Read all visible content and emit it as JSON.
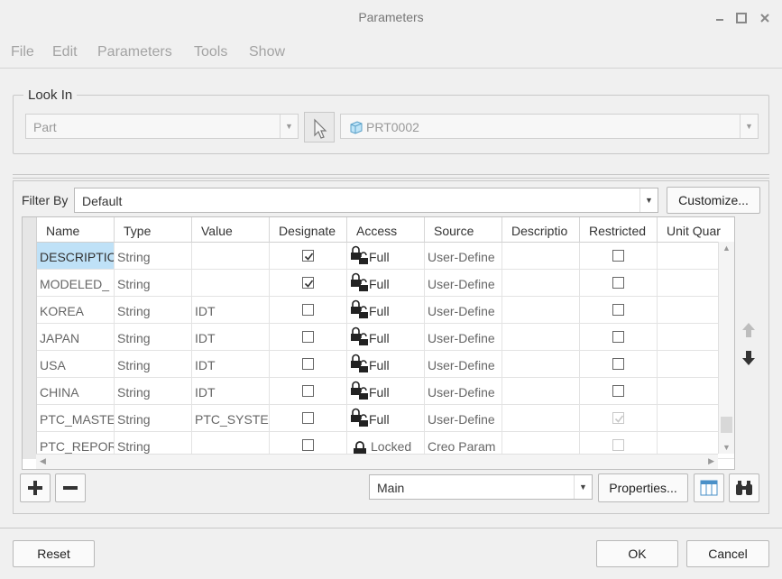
{
  "window": {
    "title": "Parameters"
  },
  "menu": [
    "File",
    "Edit",
    "Parameters",
    "Tools",
    "Show"
  ],
  "look_in": {
    "legend": "Look In",
    "type_value": "Part",
    "model_value": "PRT0002"
  },
  "filter": {
    "label": "Filter By",
    "value": "Default",
    "customize_label": "Customize..."
  },
  "table": {
    "columns": [
      "Name",
      "Type",
      "Value",
      "Designate",
      "Access",
      "Source",
      "Descriptio",
      "Restricted",
      "Unit Quar"
    ],
    "rows": [
      {
        "name": "DESCRIPTIC",
        "type": "String",
        "value": "",
        "designate": true,
        "access": "Full",
        "source": "User-Define",
        "description": "",
        "restricted": false,
        "restricted_disabled": false,
        "selected": true
      },
      {
        "name": "MODELED_",
        "type": "String",
        "value": "",
        "designate": true,
        "access": "Full",
        "source": "User-Define",
        "description": "",
        "restricted": false,
        "restricted_disabled": false,
        "selected": false
      },
      {
        "name": "KOREA",
        "type": "String",
        "value": "IDT",
        "designate": false,
        "access": "Full",
        "source": "User-Define",
        "description": "",
        "restricted": false,
        "restricted_disabled": false,
        "selected": false
      },
      {
        "name": "JAPAN",
        "type": "String",
        "value": "IDT",
        "designate": false,
        "access": "Full",
        "source": "User-Define",
        "description": "",
        "restricted": false,
        "restricted_disabled": false,
        "selected": false
      },
      {
        "name": "USA",
        "type": "String",
        "value": "IDT",
        "designate": false,
        "access": "Full",
        "source": "User-Define",
        "description": "",
        "restricted": false,
        "restricted_disabled": false,
        "selected": false
      },
      {
        "name": "CHINA",
        "type": "String",
        "value": "IDT",
        "designate": false,
        "access": "Full",
        "source": "User-Define",
        "description": "",
        "restricted": false,
        "restricted_disabled": false,
        "selected": false
      },
      {
        "name": "PTC_MASTE",
        "type": "String",
        "value": "PTC_SYSTEM",
        "designate": false,
        "access": "Full",
        "source": "User-Define",
        "description": "",
        "restricted": true,
        "restricted_disabled": true,
        "selected": false
      },
      {
        "name": "PTC_REPOR",
        "type": "String",
        "value": "",
        "designate": false,
        "access": "Locked",
        "source": "Creo Param",
        "description": "",
        "restricted": false,
        "restricted_disabled": true,
        "selected": false
      }
    ]
  },
  "bottom_bar": {
    "view_value": "Main",
    "properties_label": "Properties..."
  },
  "footer": {
    "reset_label": "Reset",
    "ok_label": "OK",
    "cancel_label": "Cancel"
  },
  "colors": {
    "selected_cell": "#bfe1f7",
    "disabled_text": "#a3a3a3",
    "border": "#c8c8c8"
  }
}
